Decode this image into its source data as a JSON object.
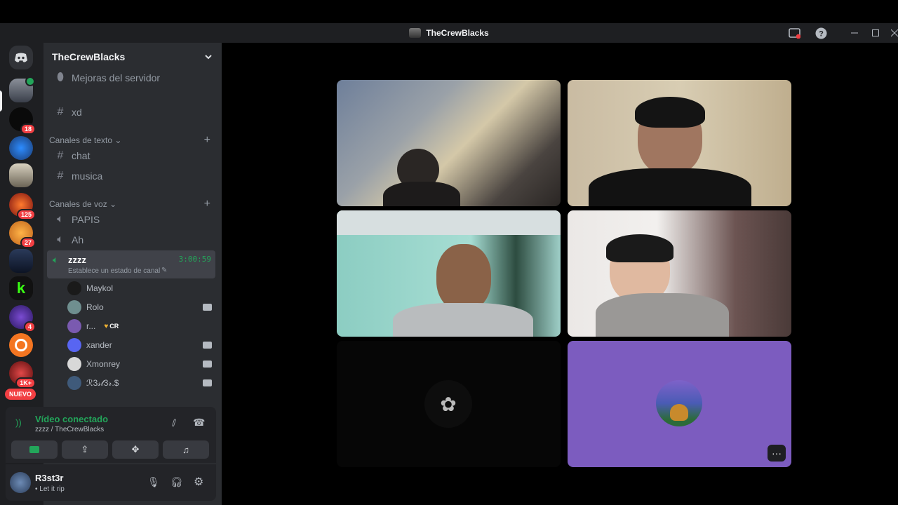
{
  "window": {
    "title": "TheCrewBlacks"
  },
  "guilds": [
    {
      "badge": ""
    },
    {
      "badge": "18"
    },
    {
      "badge": ""
    },
    {
      "badge": ""
    },
    {
      "badge": "125"
    },
    {
      "badge": "27"
    },
    {
      "badge": ""
    },
    {
      "badge": ""
    },
    {
      "badge": "4"
    },
    {
      "badge": ""
    },
    {
      "badge": "1K+"
    }
  ],
  "guild_new_label": "NUEVO",
  "server": {
    "name": "TheCrewBlacks"
  },
  "channels": {
    "boost": "Mejoras del servidor",
    "xd": "xd",
    "text_category": "Canales de texto",
    "text": [
      "chat",
      "musica"
    ],
    "voice_category": "Canales de voz",
    "voice": [
      "PAPIS",
      "Ah"
    ],
    "active_voice": {
      "name": "zzzz",
      "timer": "3:00:59",
      "status": "Establece un estado de canal"
    }
  },
  "voice_users": [
    {
      "name": "Maykol",
      "camera": false
    },
    {
      "name": "Rolo",
      "camera": true
    },
    {
      "name": "r...",
      "tag": "CR",
      "camera": false
    },
    {
      "name": "xander",
      "camera": true
    },
    {
      "name": "Xmonrey",
      "camera": true
    },
    {
      "name": "ℛ3𝓈𝓉3𝓇.$",
      "camera": true
    }
  ],
  "connection": {
    "status": "Vídeo conectado",
    "location": "zzzz / TheCrewBlacks"
  },
  "user": {
    "name": "R3st3r",
    "status": "• Let it rip"
  },
  "stage": {
    "more_label": "···"
  },
  "colors": {
    "accent": "#23a55a",
    "blurple": "#5865f2",
    "danger": "#f23f43",
    "tile_purple": "#7c5cbf"
  }
}
